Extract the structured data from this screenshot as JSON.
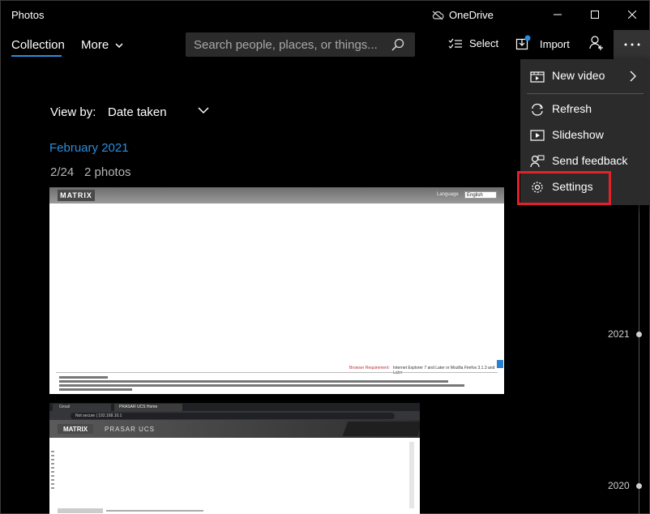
{
  "window": {
    "title": "Photos",
    "onedrive_label": "OneDrive"
  },
  "nav": {
    "tab_collection": "Collection",
    "tab_more": "More",
    "search_placeholder": "Search people, places, or things...",
    "select_label": "Select",
    "import_label": "Import"
  },
  "content": {
    "view_by_label": "View by:",
    "view_by_value": "Date taken",
    "month_header": "February 2021",
    "day_date": "2/24",
    "day_count": "2 photos"
  },
  "thumb1": {
    "logo": "MATRIX",
    "lang_label": "Language",
    "lang_value": "English",
    "req_label": "Browser Requirement:",
    "req_text": "Internet Explorer 7 and Later or Mozilla Firefox 3.1.3 and Later"
  },
  "thumb2": {
    "tab1": "Gmail",
    "tab2": "PRASAR UCS Home",
    "url": "Not secure | 192.168.10.1",
    "logo": "MATRIX",
    "app_title": "PRASAR UCS"
  },
  "timeline": [
    {
      "label": "2021"
    },
    {
      "label": "2020"
    }
  ],
  "menu": {
    "items": [
      {
        "label": "New video",
        "icon": "new-video-icon"
      },
      {
        "label": "Refresh",
        "icon": "refresh-icon"
      },
      {
        "label": "Slideshow",
        "icon": "slideshow-icon"
      },
      {
        "label": "Send feedback",
        "icon": "feedback-icon"
      },
      {
        "label": "Settings",
        "icon": "gear-icon"
      }
    ]
  },
  "colors": {
    "accent": "#2a8ee0",
    "highlight": "#e4202a",
    "menu_bg": "#2b2b2b"
  }
}
